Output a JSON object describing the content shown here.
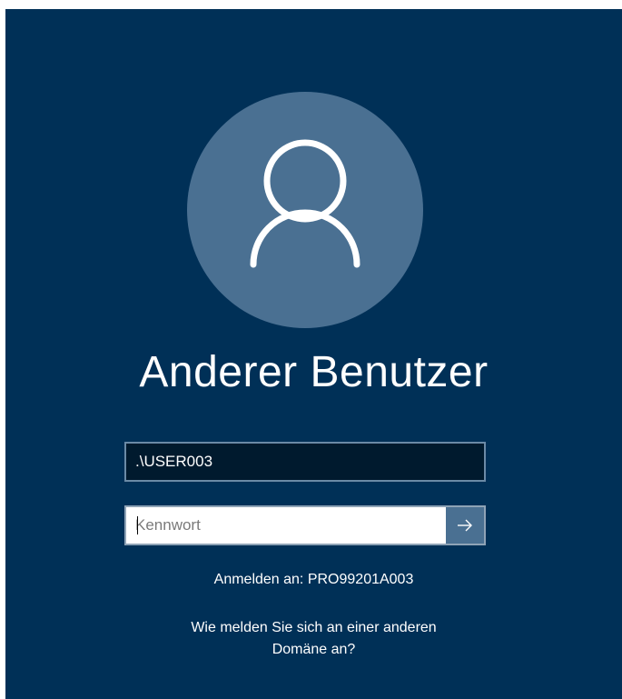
{
  "colors": {
    "background": "#003057",
    "avatar": "#4a7092",
    "username_field": "#001a2e",
    "submit_button": "#4a7092"
  },
  "user": {
    "display_name": "Anderer Benutzer",
    "avatar_icon": "user-silhouette-icon"
  },
  "username_field": {
    "value": ".\\USER003"
  },
  "password_field": {
    "value": "",
    "placeholder": "Kennwort",
    "submit_icon": "arrow-right-icon"
  },
  "sign_in_to": "Anmelden an: PRO99201A003",
  "other_domain_link": {
    "line1": "Wie melden Sie sich an einer anderen",
    "line2": "Domäne an?"
  }
}
